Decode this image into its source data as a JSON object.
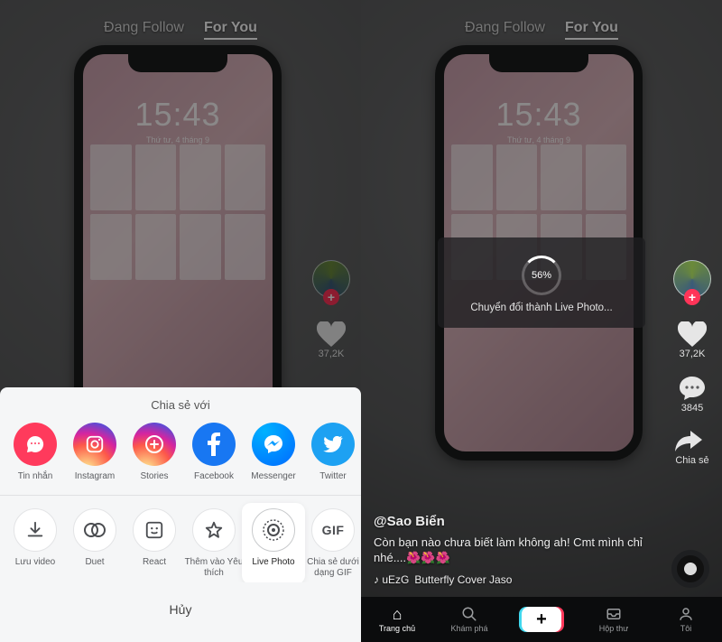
{
  "tabs": {
    "following": "Đang Follow",
    "for_you": "For You"
  },
  "phone": {
    "time": "15:43",
    "date": "Thứ tư, 4 tháng 9"
  },
  "rail": {
    "likes": "37,2K",
    "comments": "3845",
    "share": "Chia sẻ"
  },
  "share_sheet": {
    "title": "Chia sẻ với",
    "apps": [
      {
        "key": "msg",
        "label": "Tin nhắn"
      },
      {
        "key": "ig",
        "label": "Instagram"
      },
      {
        "key": "story",
        "label": "Stories"
      },
      {
        "key": "fb",
        "label": "Facebook"
      },
      {
        "key": "mess",
        "label": "Messenger"
      },
      {
        "key": "tw",
        "label": "Twitter"
      }
    ],
    "actions": [
      {
        "key": "save",
        "label": "Lưu video"
      },
      {
        "key": "duet",
        "label": "Duet"
      },
      {
        "key": "react",
        "label": "React"
      },
      {
        "key": "fav",
        "label": "Thêm vào Yêu thích"
      },
      {
        "key": "live",
        "label": "Live Photo"
      },
      {
        "key": "gif",
        "label": "Chia sẻ dưới dạng GIF",
        "glyph": "GIF"
      }
    ],
    "cancel": "Hủy"
  },
  "progress": {
    "percent": "56%",
    "message": "Chuyển đổi thành Live Photo..."
  },
  "caption": {
    "user": "@Sao Biển",
    "body": "Còn bạn nào chưa biết làm không ah! Cmt mình chỉ nhé....🌺🌺🌺",
    "music_prefix": "♪  uEzG",
    "music_title": "Butterfly Cover Jaso"
  },
  "nav": {
    "home": "Trang chủ",
    "search": "Khám phá",
    "inbox": "Hộp thư",
    "me": "Tôi"
  }
}
